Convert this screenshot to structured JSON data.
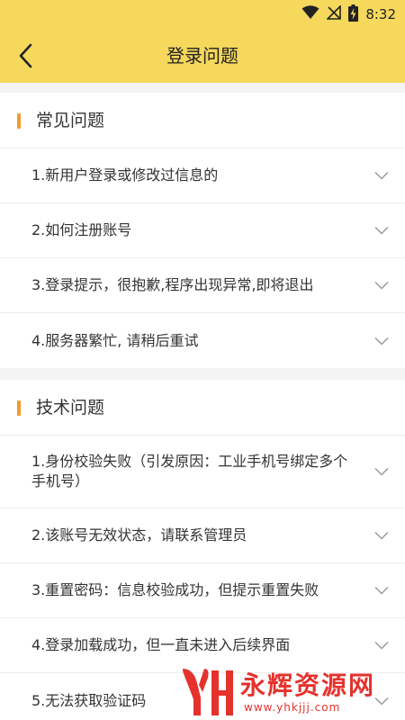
{
  "status_bar": {
    "time": "8:32",
    "icons": [
      "wifi-icon",
      "no-signal-icon",
      "battery-charging-icon"
    ]
  },
  "app_bar": {
    "title": "登录问题",
    "back_icon": "back-arrow-icon"
  },
  "sections": [
    {
      "title": "常见问题",
      "items": [
        "1.新用户登录或修改过信息的",
        "2.如何注册账号",
        "3.登录提示，很抱歉,程序出现异常,即将退出",
        "4.服务器繁忙, 请稍后重试"
      ]
    },
    {
      "title": "技术问题",
      "items": [
        "1.身份校验失败（引发原因：工业手机号绑定多个手机号）",
        "2.该账号无效状态，请联系管理员",
        "3.重置密码：信息校验成功，但提示重置失败",
        "4.登录加载成功，但一直未进入后续界面",
        "5.无法获取验证码"
      ]
    }
  ],
  "watermark": {
    "name": "永辉资源网",
    "url": "www.yhkjjj.com"
  },
  "colors": {
    "header": "#f5d85c",
    "section_marker": "#f39a2b",
    "watermark": "#e5322d",
    "background": "#f4f4f4"
  }
}
